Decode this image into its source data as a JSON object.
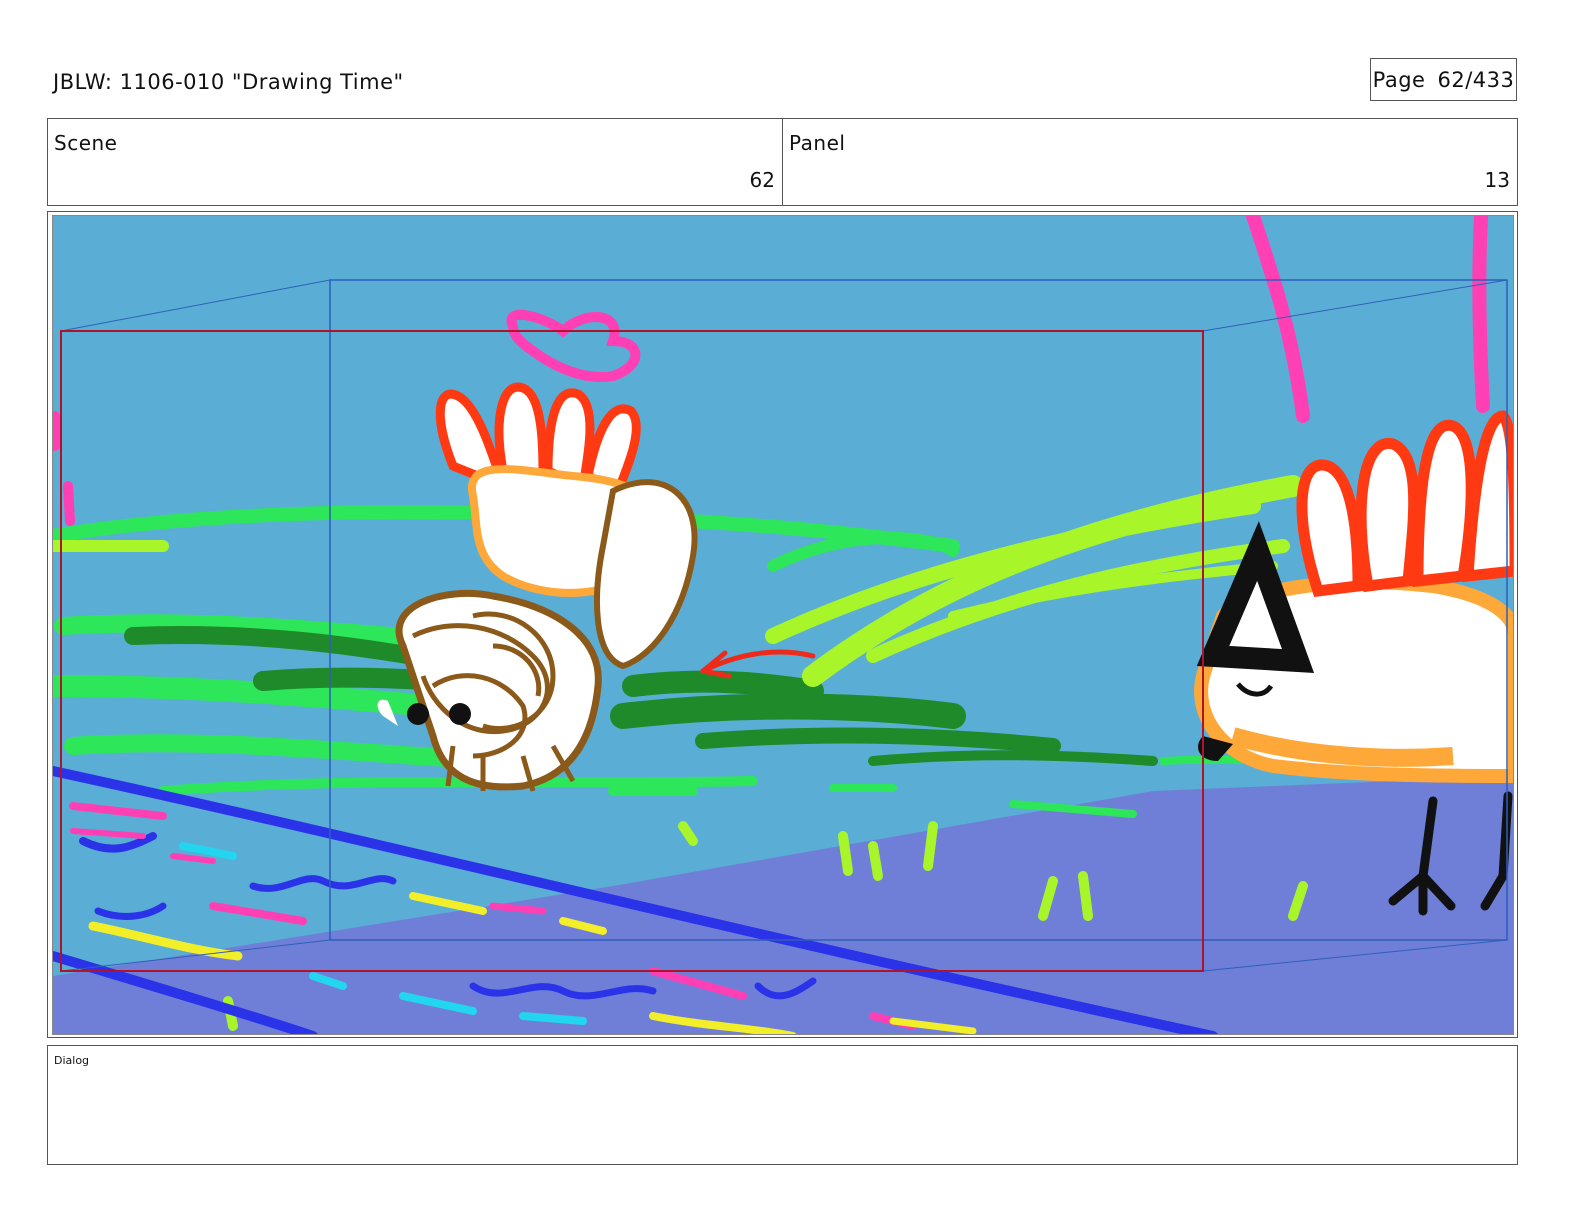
{
  "header": {
    "title": "JBLW: 1106-010 \"Drawing Time\"",
    "page_label": "Page",
    "page_number": "62/433"
  },
  "scene": {
    "label": "Scene",
    "value": "62"
  },
  "panel": {
    "label": "Panel",
    "value": "13"
  },
  "dialog": {
    "label": "Dialog"
  },
  "colors": {
    "sky": "#5aaed6",
    "ground": "#6f7fd8",
    "grass_green": "#2ee65a",
    "dark_green": "#1f8a2a",
    "lime": "#a8f52a",
    "pink": "#ff3fb4",
    "blue_stroke": "#2a33e8",
    "cyan": "#22d6f0",
    "yellow": "#f2ee2a",
    "brown": "#8b5a1b",
    "orange": "#ffa83a",
    "red_orange": "#ff3a12",
    "arrow_red": "#ee2a1a",
    "frame_red": "#b0142a",
    "frame_blue": "#2e5fb8"
  }
}
